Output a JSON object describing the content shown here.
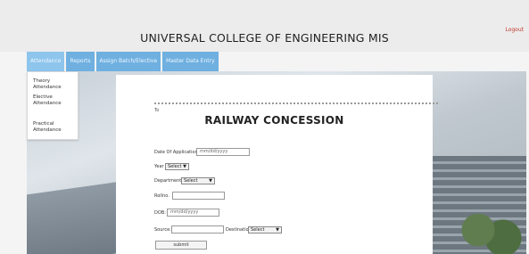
{
  "header": {
    "title": "UNIVERSAL COLLEGE OF ENGINEERING MIS",
    "logout_label": "Logout"
  },
  "nav": {
    "items": [
      {
        "label": "Attendance"
      },
      {
        "label": "Reports"
      },
      {
        "label": "Assign Batch/Elective"
      },
      {
        "label": "Master Data Entry"
      }
    ]
  },
  "dropdown": {
    "items": [
      {
        "label": "Theory Attendance"
      },
      {
        "label_line1": "Elective",
        "label_line2": "Attendance"
      },
      {
        "label_line1": "Practical",
        "label_line2": "Attendance"
      }
    ]
  },
  "form": {
    "to_label": "To",
    "title": "RAILWAY CONCESSION",
    "date_of_application_label": "Date Of Application:",
    "date_placeholder": "mm/dd/yyyy",
    "year_label": "Year",
    "year_value": "Select",
    "department_label": "Department",
    "department_value": "Select",
    "rollno_label": "Rollno.",
    "dob_label": "DOB:",
    "dob_placeholder": "mm/dd/yyyy",
    "source_label": "Source:",
    "destination_label": "Destination",
    "destination_value": "Select",
    "submit_label": "submit"
  },
  "colors": {
    "nav_bg": "#6fb0e0",
    "logout": "#c0392b"
  }
}
